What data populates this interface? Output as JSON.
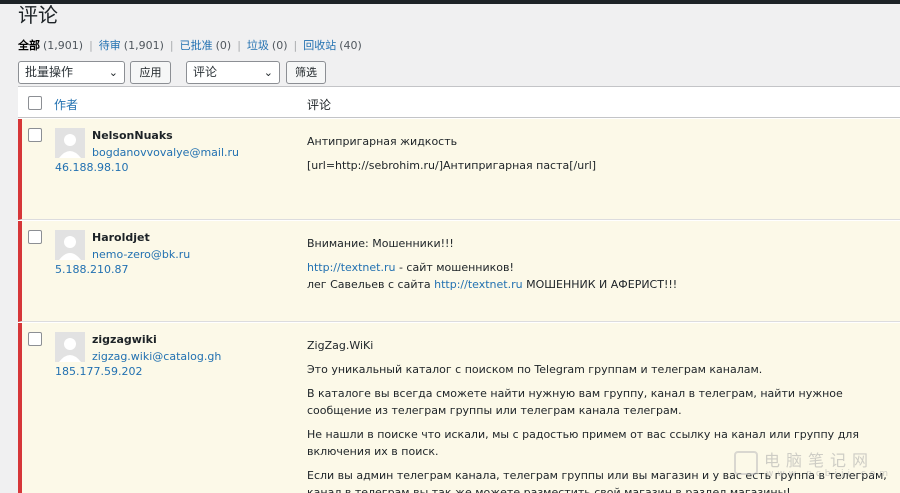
{
  "page": {
    "title": "评论"
  },
  "filters": [
    {
      "label": "全部",
      "count": "(1,901)",
      "current": true
    },
    {
      "label": "待审",
      "count": "(1,901)",
      "current": false
    },
    {
      "label": "已批准",
      "count": "(0)",
      "current": false
    },
    {
      "label": "垃圾",
      "count": "(0)",
      "current": false
    },
    {
      "label": "回收站",
      "count": "(40)",
      "current": false
    }
  ],
  "filter_sep": "|",
  "bulk": {
    "selected": "批量操作",
    "apply_label": "应用"
  },
  "type_filter": {
    "selected": "评论",
    "filter_label": "筛选"
  },
  "table": {
    "col_author": "作者",
    "col_comment": "评论"
  },
  "comments": [
    {
      "name": "NelsonNuaks",
      "email": "bogdanovvovalye@mail.ru",
      "ip": "46.188.98.10",
      "p1": "Антипригарная жидкость",
      "p2": "[url=http://sebrohim.ru/]Антипригарная паста[/url]"
    },
    {
      "name": "Haroldjet",
      "email": "nemo-zero@bk.ru",
      "ip": "5.188.210.87",
      "p1": "Внимание: Мошенники!!!",
      "link1": "http://textnet.ru",
      "p2_tail": " - сайт мошенников!",
      "p3_head": "лег Савельев с сайта ",
      "link2": "http://textnet.ru",
      "p3_tail": " МОШЕННИК И АФЕРИСТ!!!"
    },
    {
      "name": "zigzagwiki",
      "email": "zigzag.wiki@catalog.gh",
      "ip": "185.177.59.202",
      "p1": "ZigZag.WiKi",
      "p2": "Это уникальный каталог с поиском по Telegram группам и телеграм каналам.",
      "p3": "В каталоге вы всегда сможете найти нужную вам группу, канал в телеграм, найти нужное сообщение из телеграм группы или телеграм канала телеграм.",
      "p4": "Не нашли в поиске что искали, мы с радостью примем от вас ссылку на канал или группу для включения их в поиск.",
      "p5": "Если вы админ телеграм канала, телеграм группы или вы магазин и у вас есть группа в телеграм, канал в телеграм вы так же можете разместить свой магазин в раздел магазины!"
    }
  ],
  "watermark": {
    "cn": "电脑笔记网",
    "url": "www.pcbiji.com"
  },
  "colors": {
    "accent": "#2271b1",
    "pending_border": "#d63638",
    "pending_bg": "#fcf9e8"
  }
}
